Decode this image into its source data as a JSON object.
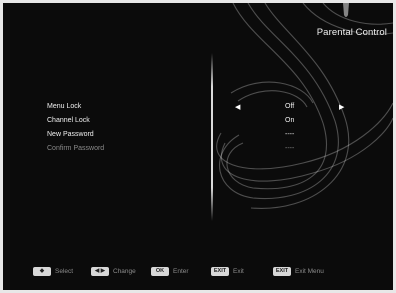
{
  "screen": {
    "title": "Parental Control"
  },
  "menu": {
    "rows": [
      {
        "label": "Menu Lock",
        "value": "Off",
        "left_arrow": "◀",
        "right_arrow": "▶"
      },
      {
        "label": "Channel Lock",
        "value": "On"
      },
      {
        "label": "New Password",
        "value": "----"
      },
      {
        "label": "Confirm Password",
        "value": "----"
      }
    ]
  },
  "footer": {
    "hints": [
      {
        "key": "◆",
        "label": "Select"
      },
      {
        "key": "◀ ▶",
        "label": "Change"
      },
      {
        "key": "OK",
        "label": "Enter"
      },
      {
        "key": "EXIT",
        "label": "Exit"
      },
      {
        "key": "EXIT",
        "label": "Exit Menu"
      }
    ]
  }
}
